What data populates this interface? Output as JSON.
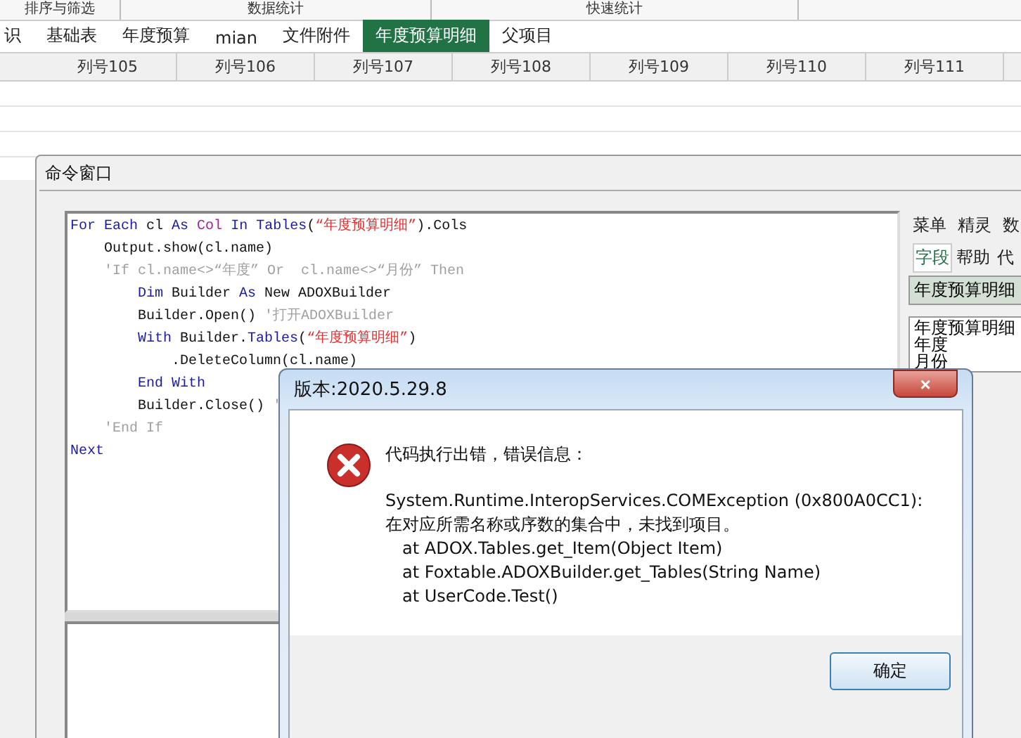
{
  "ribbon_groups": [
    "排序与筛选",
    "数据统计",
    "快速统计"
  ],
  "sheet_tabs": [
    {
      "label": "识",
      "selected": false
    },
    {
      "label": "基础表",
      "selected": false
    },
    {
      "label": "年度预算",
      "selected": false
    },
    {
      "label": "mian",
      "selected": false
    },
    {
      "label": "文件附件",
      "selected": false
    },
    {
      "label": "年度预算明细",
      "selected": true
    },
    {
      "label": "父项目",
      "selected": false
    }
  ],
  "table": {
    "columns": [
      "列号105",
      "列号106",
      "列号107",
      "列号108",
      "列号109",
      "列号110",
      "列号111"
    ]
  },
  "command_window": {
    "title": "命令窗口",
    "code_lines": [
      [
        {
          "kind": "keyword",
          "text": "For Each"
        },
        {
          "kind": "plain",
          "text": " cl "
        },
        {
          "kind": "keyword",
          "text": "As "
        },
        {
          "kind": "type",
          "text": "Col"
        },
        {
          "kind": "keyword",
          "text": " In Tables"
        },
        {
          "kind": "plain",
          "text": "("
        },
        {
          "kind": "string",
          "text": "“年度预算明细”"
        },
        {
          "kind": "plain",
          "text": ").Cols"
        }
      ],
      [
        {
          "kind": "plain",
          "text": "    Output.show(cl.name)"
        }
      ],
      [
        {
          "kind": "comment",
          "text": "    'If cl.name<>“年度” Or  cl.name<>“月份” Then"
        }
      ],
      [
        {
          "kind": "keyword",
          "text": "        Dim"
        },
        {
          "kind": "plain",
          "text": " Builder "
        },
        {
          "kind": "keyword",
          "text": "As"
        },
        {
          "kind": "plain",
          "text": " New ADOXBuilder"
        }
      ],
      [
        {
          "kind": "plain",
          "text": "        Builder.Open() "
        },
        {
          "kind": "comment",
          "text": "'打开ADOXBuilder"
        }
      ],
      [
        {
          "kind": "keyword",
          "text": "        With"
        },
        {
          "kind": "plain",
          "text": " Builder."
        },
        {
          "kind": "keyword",
          "text": "Tables"
        },
        {
          "kind": "plain",
          "text": "("
        },
        {
          "kind": "string",
          "text": "“年度预算明细”"
        },
        {
          "kind": "plain",
          "text": ")"
        }
      ],
      [
        {
          "kind": "plain",
          "text": "            .DeleteColumn(cl.name)"
        }
      ],
      [
        {
          "kind": "keyword",
          "text": "        End With"
        }
      ],
      [
        {
          "kind": "plain",
          "text": "        Builder.Close() "
        },
        {
          "kind": "comment",
          "text": "'"
        }
      ],
      [
        {
          "kind": "comment",
          "text": "    'End If"
        }
      ],
      [
        {
          "kind": "keyword",
          "text": "Next"
        }
      ]
    ],
    "side_menu": [
      "菜单",
      "精灵",
      "数"
    ],
    "side_tabs": [
      {
        "label": "字段",
        "selected": true
      },
      {
        "label": "帮助",
        "selected": false
      },
      {
        "label": "代",
        "selected": false
      }
    ],
    "table_header": "年度预算明细",
    "field_list": [
      "年度预算明细",
      "年度",
      "月份"
    ]
  },
  "dialog": {
    "title": "版本:2020.5.29.8",
    "close": "×",
    "heading": "代码执行出错，错误信息：",
    "message": "System.Runtime.InteropServices.COMException (0x800A0CC1): 在对应所需名称或序数的集合中，未找到项目。",
    "stack": [
      "at ADOX.Tables.get_Item(Object Item)",
      "at Foxtable.ADOXBuilder.get_Tables(String Name)",
      "at UserCode.Test()"
    ],
    "buttons": [
      "确定"
    ]
  }
}
